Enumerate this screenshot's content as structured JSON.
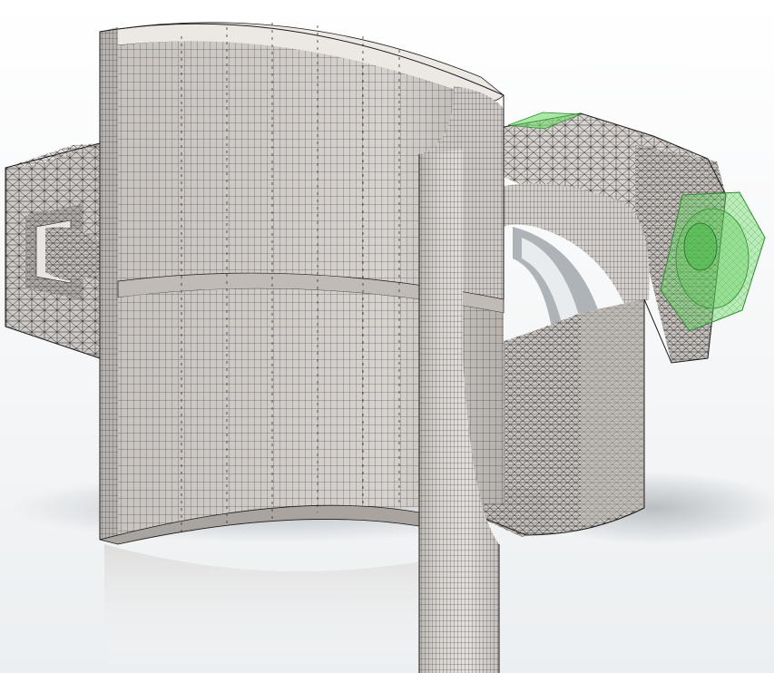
{
  "scene": {
    "subject": "",
    "colors": {
      "background_top": "#ffffff",
      "background_bottom": "#eceff1",
      "mesh_face": "#d8d3cf",
      "mesh_face_dark": "#b9b4b0",
      "mesh_face_light": "#e6e2de",
      "mesh_line": "#1c1c1c",
      "bolt_fill": "#6fdc6a",
      "bolt_stroke": "#2e8b2e",
      "shadow": "#9aa0a6"
    }
  }
}
